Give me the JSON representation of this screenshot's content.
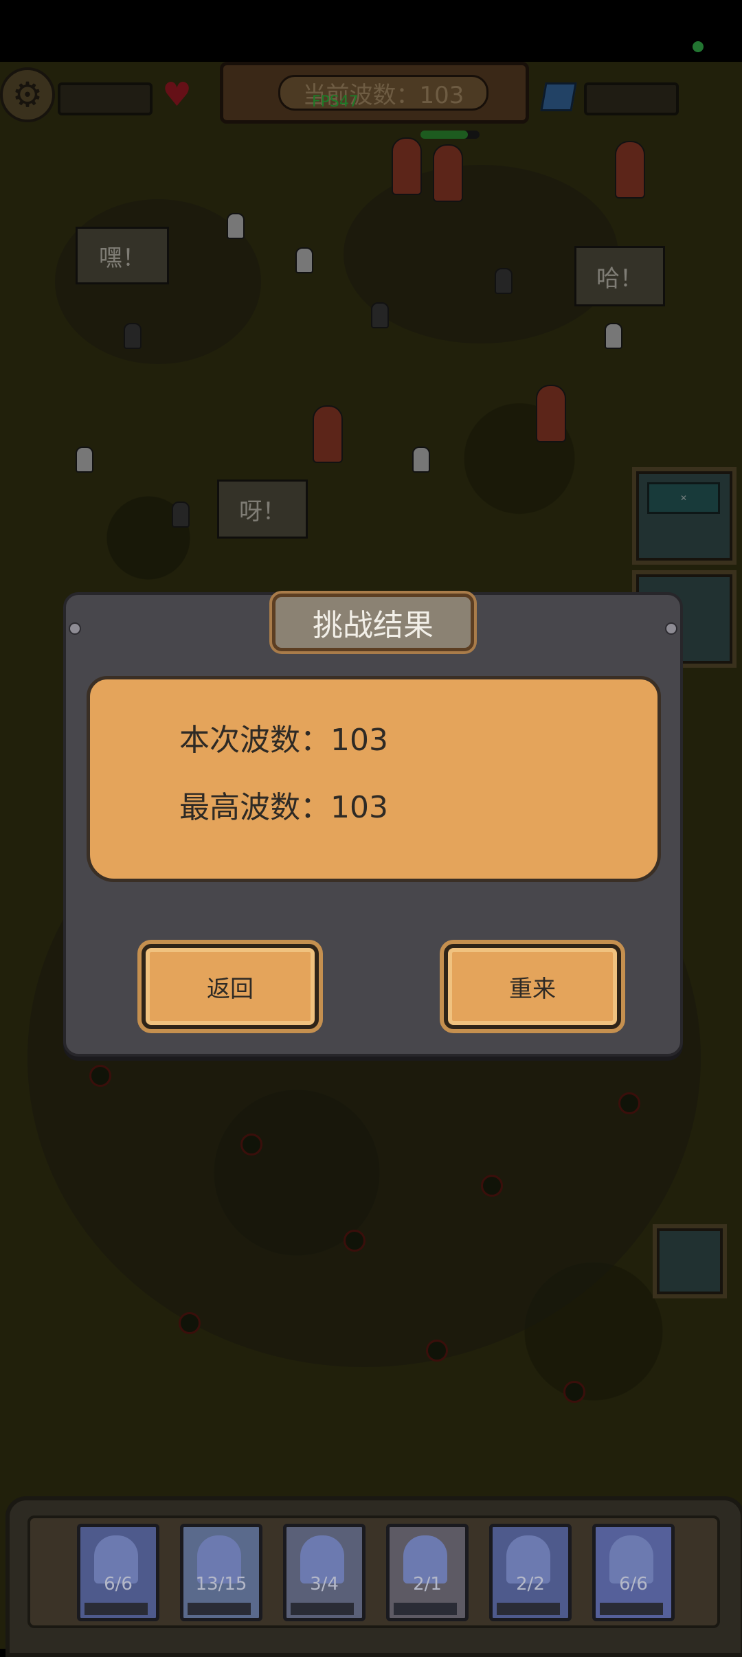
{
  "hud": {
    "wave_banner_text": "当前波数：103",
    "fps_text": "FPS47",
    "wave_progress": 0.8
  },
  "battlefield": {
    "speech_bubbles": [
      "嘿！",
      "哈！",
      "呀！"
    ]
  },
  "dialog": {
    "title": "挑战结果",
    "current_wave_label": "本次波数：103",
    "best_wave_label": "最高波数：103",
    "back_button": "返回",
    "retry_button": "重来"
  },
  "unit_cards": [
    {
      "count": "6/6"
    },
    {
      "count": "13/15"
    },
    {
      "count": "3/4"
    },
    {
      "count": "2/1"
    },
    {
      "count": "2/2"
    },
    {
      "count": "6/6"
    }
  ],
  "colors": {
    "dialog_bg": "#48474c",
    "paper": "#e4a45b",
    "field": "#3c3b14",
    "fps": "#38e04a"
  },
  "icons": [
    "gear-icon",
    "heart-icon",
    "cube-icon"
  ]
}
